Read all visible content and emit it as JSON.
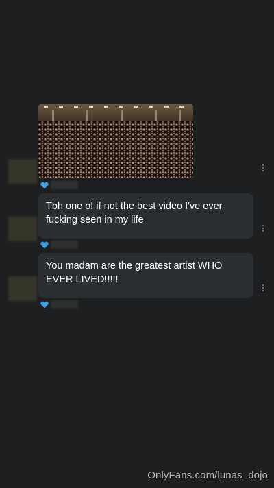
{
  "messages": [
    {
      "type": "media",
      "liked": true
    },
    {
      "type": "text",
      "text": "Tbh one of if not the best video I've ever fucking seen in my life",
      "liked": true
    },
    {
      "type": "text",
      "text": "You madam are the greatest artist WHO EVER LIVED!!!!!",
      "liked": true
    }
  ],
  "colors": {
    "background": "#1e1f21",
    "bubble": "#2b2e31",
    "heart": "#3aa0e8"
  },
  "watermark": "OnlyFans.com/lunas_dojo",
  "icons": [
    "heart-icon",
    "more-options-icon"
  ]
}
